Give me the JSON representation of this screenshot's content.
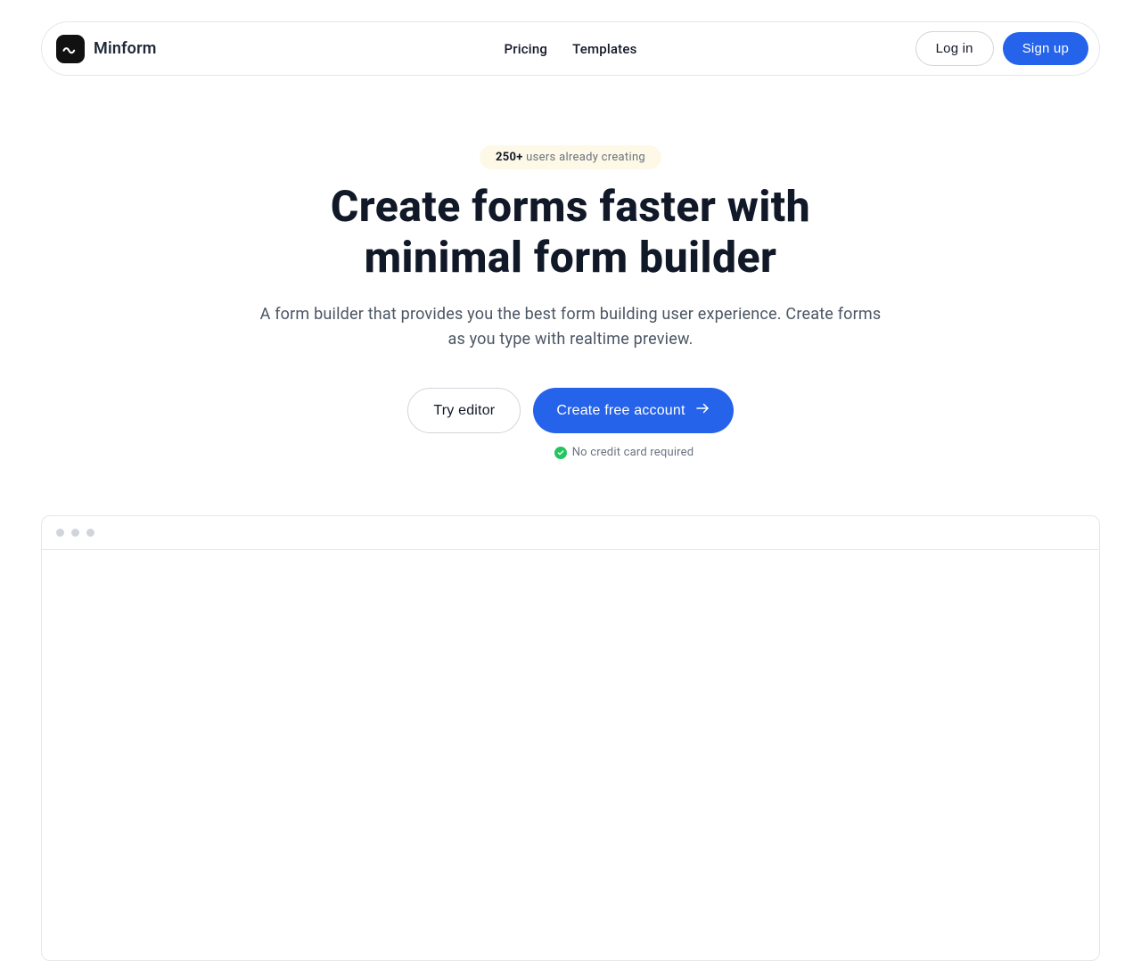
{
  "nav": {
    "brand": "Minform",
    "links": [
      "Pricing",
      "Templates"
    ],
    "login": "Log in",
    "signup": "Sign up"
  },
  "hero": {
    "badge_count": "250+",
    "badge_text": "users already creating",
    "title_line1": "Create forms faster with",
    "title_line2": "minimal form builder",
    "subtitle": "A form builder that provides you the best form building user experience. Create forms as you type with realtime preview.",
    "cta_secondary": "Try editor",
    "cta_primary": "Create free account",
    "cta_note": "No credit card required"
  }
}
